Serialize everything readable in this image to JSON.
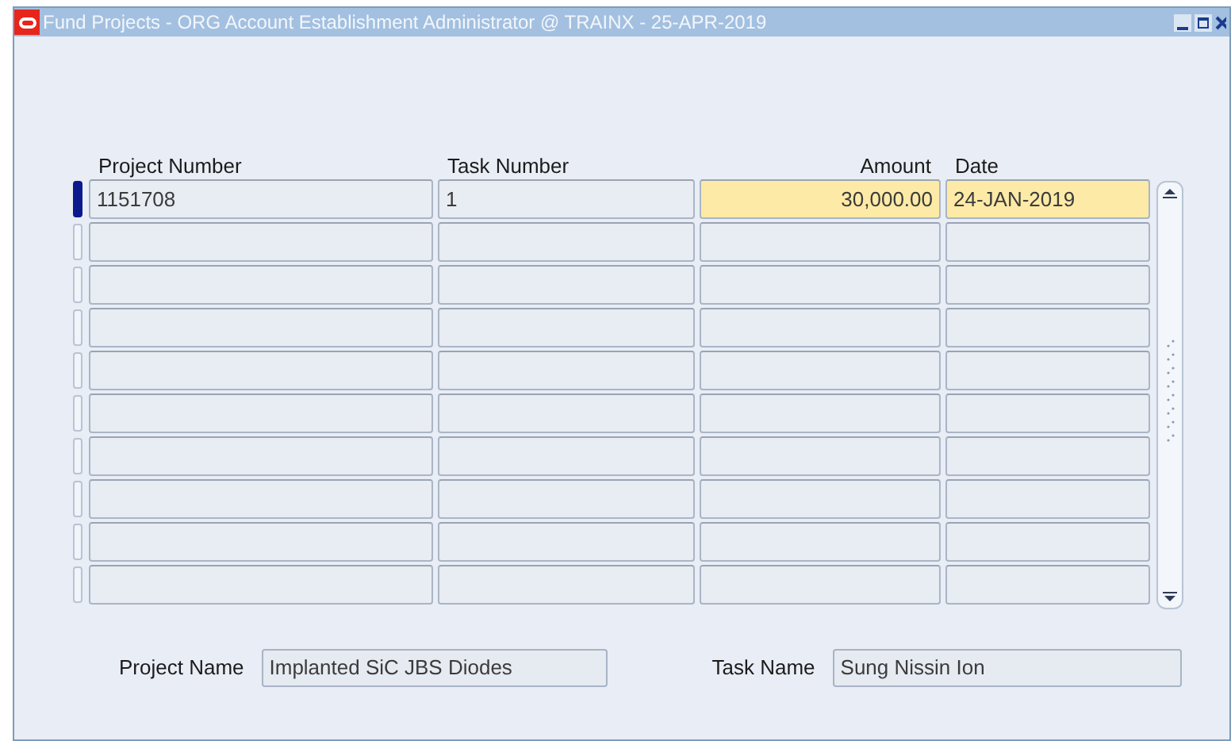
{
  "window": {
    "title": "Fund Projects - ORG Account Establishment Administrator @ TRAINX - 25-APR-2019"
  },
  "table": {
    "columns": [
      {
        "label": "Project Number",
        "kind": "text"
      },
      {
        "label": "Task Number",
        "kind": "text"
      },
      {
        "label": "Amount",
        "kind": "numeric"
      },
      {
        "label": "Date",
        "kind": "text"
      }
    ],
    "rows": [
      {
        "selected": true,
        "cells": [
          {
            "text": "1151708",
            "required": false
          },
          {
            "text": "1",
            "required": false
          },
          {
            "text": "30,000.00",
            "required": true
          },
          {
            "text": "24-JAN-2019",
            "required": true
          }
        ]
      },
      {
        "selected": false
      },
      {
        "selected": false
      },
      {
        "selected": false
      },
      {
        "selected": false
      },
      {
        "selected": false
      },
      {
        "selected": false
      },
      {
        "selected": false
      },
      {
        "selected": false
      },
      {
        "selected": false
      }
    ]
  },
  "fields": [
    {
      "label": "Project Name",
      "value": "Implanted SiC JBS Diodes"
    },
    {
      "label": "Task Name",
      "value": "Sung Nissin Ion"
    }
  ]
}
